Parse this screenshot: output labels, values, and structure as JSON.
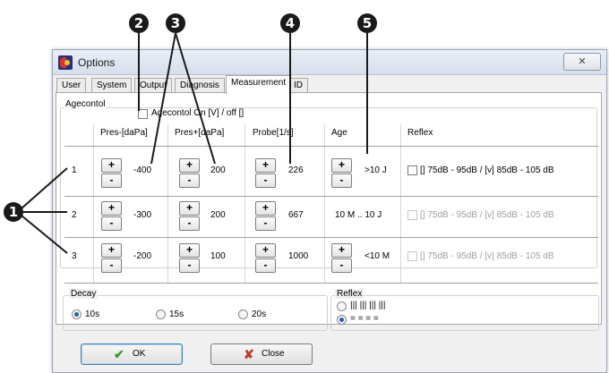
{
  "callouts": [
    "1",
    "2",
    "3",
    "4",
    "5"
  ],
  "window": {
    "title": "Options",
    "close_icon": "close-icon"
  },
  "tabs": [
    {
      "label": "User"
    },
    {
      "label": "System"
    },
    {
      "label": "Output"
    },
    {
      "label": "Diagnosis"
    },
    {
      "label": "Measurement"
    },
    {
      "label": "ID"
    }
  ],
  "active_tab": "Measurement",
  "agecontrol": {
    "group_label": "Agecontol",
    "checkbox_label": "Agecontol On [V] / off []",
    "checked": false
  },
  "table": {
    "headers": [
      "Pres-[daPa]",
      "Pres+[daPa]",
      "Probe[1/s]",
      "Age",
      "Reflex"
    ],
    "plus": "+",
    "minus": "-",
    "rows": [
      {
        "num": "1",
        "pres_minus": "-400",
        "pres_plus": "200",
        "probe": "226",
        "age": ">10 J",
        "reflex": "[] 75dB  - 95dB / [v] 85dB - 105 dB",
        "reflex_enabled": true
      },
      {
        "num": "2",
        "pres_minus": "-300",
        "pres_plus": "200",
        "probe": "667",
        "age": "10 M .. 10 J",
        "reflex": "[] 75dB  - 95dB / [v] 85dB - 105 dB",
        "reflex_enabled": false
      },
      {
        "num": "3",
        "pres_minus": "-200",
        "pres_plus": "100",
        "probe": "1000",
        "age": "<10 M",
        "reflex": "[] 75dB  - 95dB / [v] 85dB - 105 dB",
        "reflex_enabled": false
      }
    ]
  },
  "decay": {
    "label": "Decay",
    "options": [
      "10s",
      "15s",
      "20s"
    ],
    "selected": "10s"
  },
  "reflex_group": {
    "label": "Reflex",
    "options": [
      "||| ||| ||| |||",
      "= = = ="
    ],
    "selected": "= = = ="
  },
  "buttons": {
    "ok": "OK",
    "close": "Close"
  },
  "colors": {
    "ok_check": "#3a9a2a",
    "close_x": "#c0392b",
    "radio_selected": "#1f5fb3"
  }
}
